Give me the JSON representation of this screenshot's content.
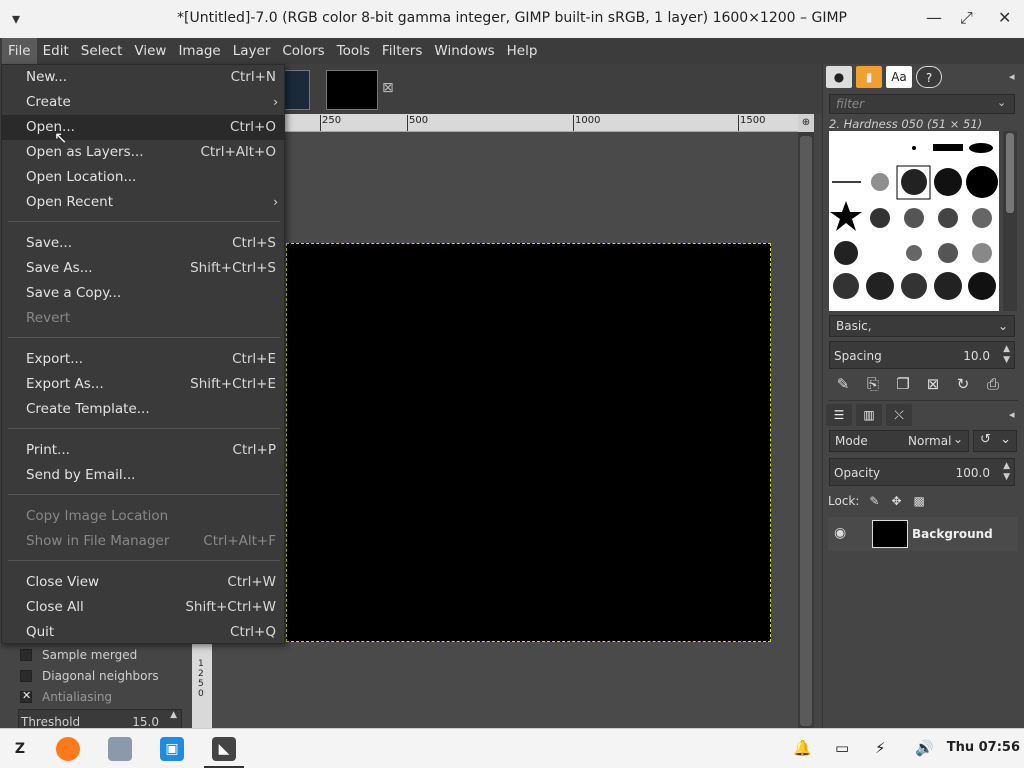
{
  "window": {
    "title": "*[Untitled]-7.0 (RGB color 8-bit gamma integer, GIMP built-in sRGB, 1 layer) 1600×1200 – GIMP"
  },
  "menubar": [
    "File",
    "Edit",
    "Select",
    "View",
    "Image",
    "Layer",
    "Colors",
    "Tools",
    "Filters",
    "Windows",
    "Help"
  ],
  "file_menu": {
    "items": [
      {
        "label": "New...",
        "accel": "Ctrl+N"
      },
      {
        "label": "Create",
        "accel": "",
        "submenu": true
      },
      {
        "label": "Open...",
        "accel": "Ctrl+O",
        "highlight": true
      },
      {
        "label": "Open as Layers...",
        "accel": "Ctrl+Alt+O"
      },
      {
        "label": "Open Location...",
        "accel": ""
      },
      {
        "label": "Open Recent",
        "accel": "",
        "submenu": true
      },
      {
        "label": "Save...",
        "accel": "Ctrl+S"
      },
      {
        "label": "Save As...",
        "accel": "Shift+Ctrl+S"
      },
      {
        "label": "Save a Copy...",
        "accel": ""
      },
      {
        "label": "Revert",
        "accel": "",
        "disabled": true
      },
      {
        "label": "Export...",
        "accel": "Ctrl+E"
      },
      {
        "label": "Export As...",
        "accel": "Shift+Ctrl+E"
      },
      {
        "label": "Create Template...",
        "accel": ""
      },
      {
        "label": "Print...",
        "accel": "Ctrl+P"
      },
      {
        "label": "Send by Email...",
        "accel": ""
      },
      {
        "label": "Copy Image Location",
        "accel": "",
        "disabled": true
      },
      {
        "label": "Show in File Manager",
        "accel": "Ctrl+Alt+F",
        "disabled": true
      },
      {
        "label": "Close View",
        "accel": "Ctrl+W"
      },
      {
        "label": "Close All",
        "accel": "Shift+Ctrl+W"
      },
      {
        "label": "Quit",
        "accel": "Ctrl+Q"
      }
    ]
  },
  "ruler": {
    "labels": [
      "250",
      "500",
      "1000",
      "1500"
    ],
    "left_labels": [
      "1",
      "2",
      "5",
      "0"
    ]
  },
  "tool_options": {
    "sample_merged": "Sample merged",
    "diagonal_neighbors": "Diagonal neighbors",
    "antialiasing": "Antialiasing",
    "threshold_label": "Threshold",
    "threshold_value": "15.0"
  },
  "brushes": {
    "filter_placeholder": "filter",
    "current_brush": "2. Hardness 050 (51 × 51)",
    "tag_value": "Basic,",
    "spacing_label": "Spacing",
    "spacing_value": "10.0"
  },
  "layers": {
    "mode_label": "Mode",
    "mode_value": "Normal",
    "opacity_label": "Opacity",
    "opacity_value": "100.0",
    "lock_label": "Lock:",
    "layer_name": "Background"
  },
  "dock_tabs": {
    "fonts_tab": "Aa",
    "help_tab": "?"
  },
  "taskbar": {
    "clock": "Thu 07:56"
  },
  "colors": {
    "accent_highlight": "#2a2a2a",
    "canvas": "#000000",
    "selection_border": "#d6d61a"
  }
}
